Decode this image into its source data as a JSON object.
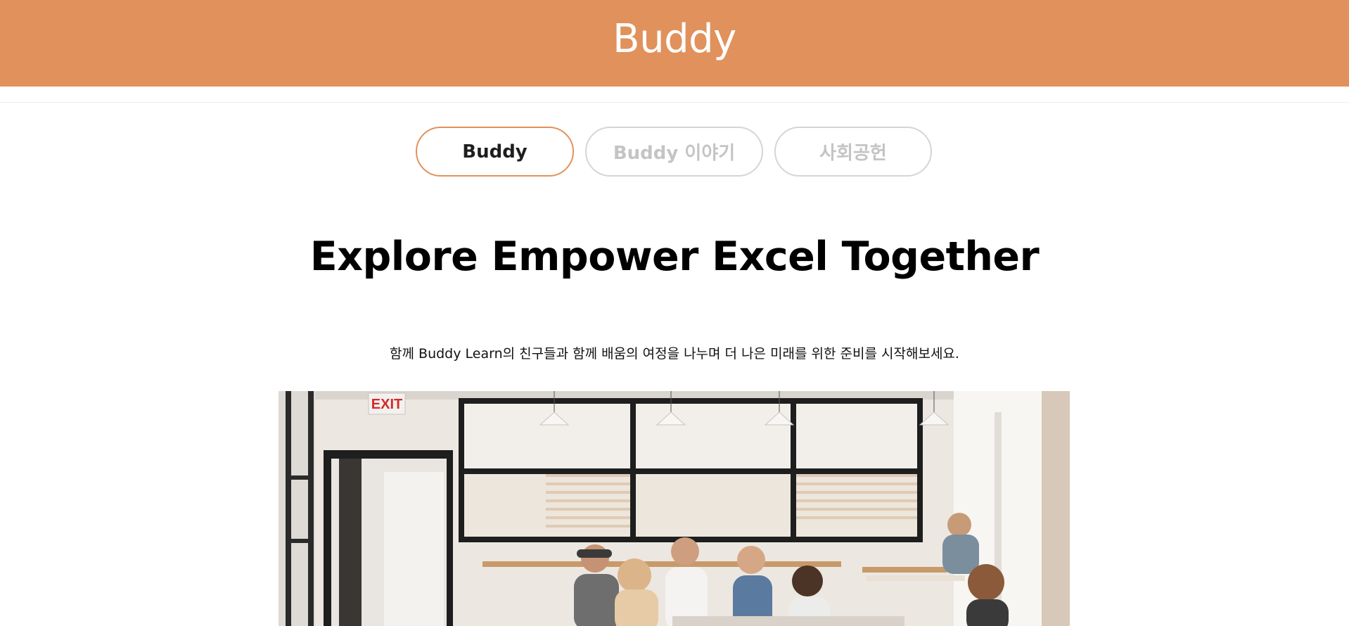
{
  "header": {
    "title": "Buddy",
    "background_color": "#e1915b"
  },
  "tabs": [
    {
      "label": "Buddy",
      "active": true
    },
    {
      "label": "Buddy 이야기",
      "active": false
    },
    {
      "label": "사회공헌",
      "active": false
    }
  ],
  "hero": {
    "title": "Explore Empower Excel Together",
    "subtitle": "함께 Buddy Learn의 친구들과 함께 배움의 여정을 나누며 더 나은 미래를 위한 준비를 시작해보세요."
  },
  "photo": {
    "exit_sign": "EXIT"
  },
  "colors": {
    "accent": "#e1915b",
    "inactive_tab": "#c4c4c4"
  }
}
